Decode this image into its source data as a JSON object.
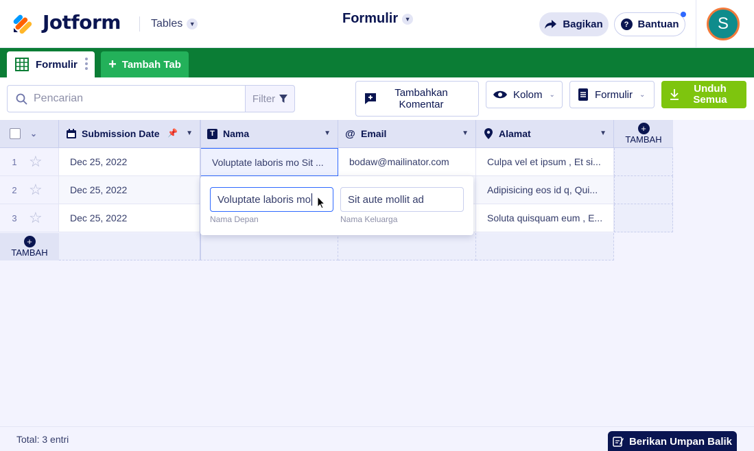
{
  "header": {
    "brand": "Jotform",
    "product_switch": "Tables",
    "form_title": "Formulir",
    "share_label": "Bagikan",
    "help_label": "Bantuan",
    "avatar_initial": "S"
  },
  "tabs": {
    "active_label": "Formulir",
    "add_label": "Tambah Tab"
  },
  "toolbar": {
    "search_placeholder": "Pencarian",
    "filter_label": "Filter",
    "add_comment_label": "Tambahkan Komentar",
    "columns_label": "Kolom",
    "form_label": "Formulir",
    "download_all_label": "Unduh Semua"
  },
  "table": {
    "columns": [
      {
        "label": "Submission Date",
        "icon": "calendar-icon"
      },
      {
        "label": "Nama",
        "icon": "text-icon"
      },
      {
        "label": "Email",
        "icon": "at-icon"
      },
      {
        "label": "Alamat",
        "icon": "location-pin-icon"
      }
    ],
    "add_column_label": "TAMBAH",
    "add_row_label": "TAMBAH",
    "rows": [
      {
        "num": "1",
        "date": "Dec 25, 2022",
        "nama": "Voluptate laboris mo Sit ...",
        "email": "bodaw@mailinator.com",
        "alamat": "Culpa vel et ipsum , Et si..."
      },
      {
        "num": "2",
        "date": "Dec 25, 2022",
        "nama": "",
        "email": "",
        "alamat": "Adipisicing eos id q, Qui..."
      },
      {
        "num": "3",
        "date": "Dec 25, 2022",
        "nama": "",
        "email": "",
        "alamat": "Soluta quisquam eum , E..."
      }
    ]
  },
  "editor": {
    "first_name_value": "Voluptate laboris mo",
    "first_name_label": "Nama Depan",
    "last_name_value": "Sit aute mollit ad",
    "last_name_label": "Nama Keluarga"
  },
  "footer": {
    "total_label": "Total: 3 entri",
    "feedback_label": "Berikan Umpan Balik"
  },
  "colors": {
    "brand_navy": "#0a1551",
    "tab_bar_green": "#0b7d35",
    "add_tab_green": "#23b15a",
    "download_green": "#7ec50e",
    "avatar_teal": "#0f8c8c",
    "avatar_ring": "#f27a3b",
    "focus_blue": "#2e69ff"
  }
}
